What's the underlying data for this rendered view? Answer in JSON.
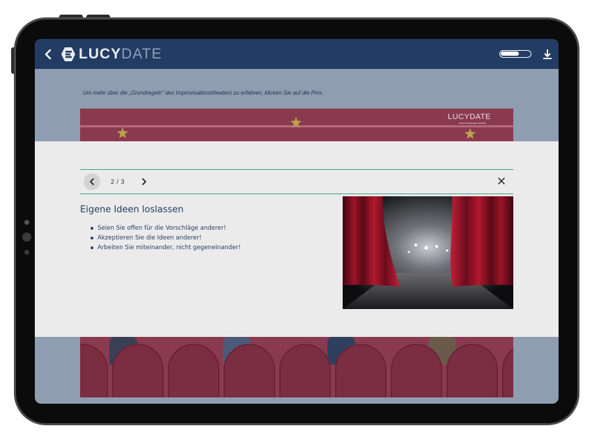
{
  "app": {
    "logo_lucy": "LUCY",
    "logo_date": "DATE",
    "back_icon": "chevron-left-icon",
    "download_icon": "download-icon"
  },
  "page": {
    "instruction": "Um mehr über die „Grundregeln“ des Improvisationstheaters zu erfahren, klicken Sie auf die Pins.",
    "banner_logo": "LUCYDATE",
    "banner_tagline": "EINFACH BESSER LERNEN"
  },
  "modal": {
    "page_indicator": "2 / 3",
    "prev_icon": "chevron-left-icon",
    "next_icon": "chevron-right-icon",
    "close_icon": "close-icon",
    "title": "Eigene Ideen loslassen",
    "bullets": [
      "Seien Sie offen für die Vorschläge anderer!",
      "Akzeptieren Sie die Ideen anderer!",
      "Arbeiten Sie miteinander, nicht gegeneinander!"
    ],
    "image_subject": "theater-stage-with-red-curtains"
  },
  "colors": {
    "header": "#223c64",
    "accent_line": "#3aa37e",
    "banner": "#8a3a4f",
    "modal_bg": "#ebebeb",
    "text": "#233d63"
  }
}
